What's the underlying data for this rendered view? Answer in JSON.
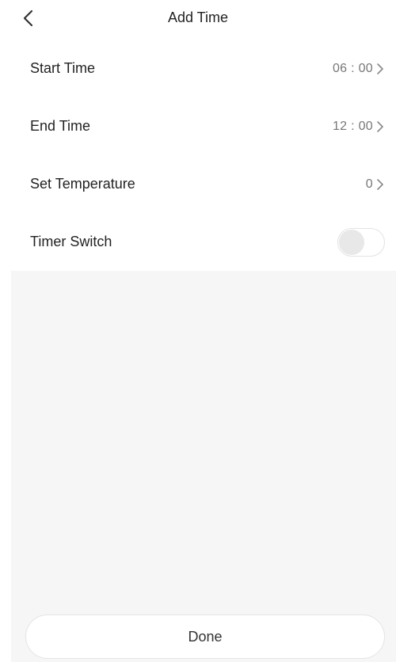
{
  "header": {
    "title": "Add Time",
    "back_icon": "chevron-left-icon"
  },
  "rows": [
    {
      "label": "Start Time",
      "value": "06 : 00"
    },
    {
      "label": "End Time",
      "value": "12 : 00"
    },
    {
      "label": "Set Temperature",
      "value": "0"
    }
  ],
  "timer_switch": {
    "label": "Timer Switch",
    "on": false
  },
  "footer": {
    "done_label": "Done"
  },
  "colors": {
    "background": "#ffffff",
    "panel": "#f6f6f6",
    "text": "#222222",
    "value_text": "#777777"
  }
}
